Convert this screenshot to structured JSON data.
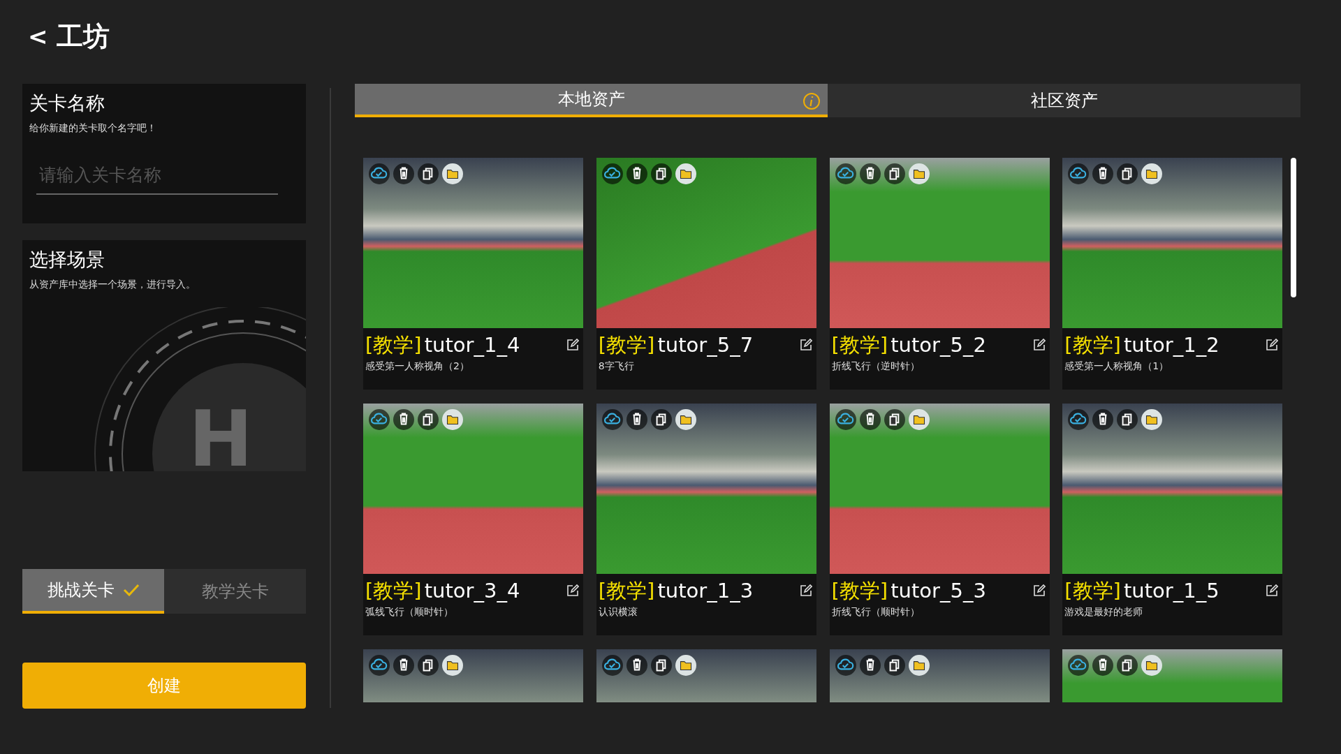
{
  "header": {
    "back": "<",
    "title": "工坊"
  },
  "name_card": {
    "title": "关卡名称",
    "hint": "给你新建的关卡取个名字吧！",
    "placeholder": "请输入关卡名称"
  },
  "scene_card": {
    "title": "选择场景",
    "hint": "从资产库中选择一个场景，进行导入。",
    "emblem": "H"
  },
  "level_types": [
    {
      "label": "挑战关卡",
      "selected": true
    },
    {
      "label": "教学关卡",
      "selected": false
    }
  ],
  "create_button": "创建",
  "asset_tabs": [
    {
      "label": "本地资产",
      "selected": true,
      "info": true
    },
    {
      "label": "社区资产",
      "selected": false,
      "info": false
    }
  ],
  "assets": [
    {
      "tag": "[教学]",
      "name": "tutor_1_4",
      "desc": "感受第一人称视角（2）",
      "kind": "stadium"
    },
    {
      "tag": "[教学]",
      "name": "tutor_5_7",
      "desc": "8字飞行",
      "kind": "field"
    },
    {
      "tag": "[教学]",
      "name": "tutor_5_2",
      "desc": "折线飞行（逆时针）",
      "kind": "track"
    },
    {
      "tag": "[教学]",
      "name": "tutor_1_2",
      "desc": "感受第一人称视角（1）",
      "kind": "stadium"
    },
    {
      "tag": "[教学]",
      "name": "tutor_3_4",
      "desc": "弧线飞行（顺时针）",
      "kind": "track"
    },
    {
      "tag": "[教学]",
      "name": "tutor_1_3",
      "desc": "认识横滚",
      "kind": "stadium"
    },
    {
      "tag": "[教学]",
      "name": "tutor_5_3",
      "desc": "折线飞行（顺时针）",
      "kind": "track"
    },
    {
      "tag": "[教学]",
      "name": "tutor_1_5",
      "desc": "游戏是最好的老师",
      "kind": "stadium"
    },
    {
      "kind": "stadium"
    },
    {
      "kind": "stadium"
    },
    {
      "kind": "stadium"
    },
    {
      "kind": "track"
    }
  ]
}
